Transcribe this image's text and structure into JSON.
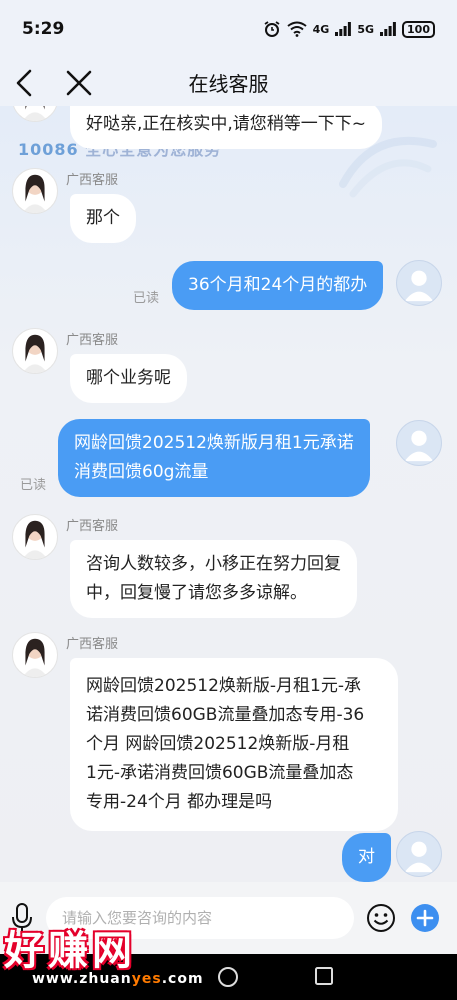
{
  "status_bar": {
    "time": "5:29",
    "network_4g": "4G",
    "network_5g": "5G",
    "battery": "100"
  },
  "header": {
    "title": "在线客服"
  },
  "watermark": {
    "brand": "10086",
    "text": "全心全意为您服务"
  },
  "messages": [
    {
      "side": "agent",
      "text": "好哒亲,正在核实中,请您稍等一下下~"
    },
    {
      "side": "agent",
      "sender": "广西客服",
      "text": "那个"
    },
    {
      "side": "user",
      "status": "已读",
      "text": "36个月和24个月的都办"
    },
    {
      "side": "agent",
      "sender": "广西客服",
      "text": "哪个业务呢"
    },
    {
      "side": "user",
      "status": "已读",
      "lines": [
        "网龄回馈202512焕新版月租1元承诺",
        "消费回馈60g流量"
      ]
    },
    {
      "side": "agent",
      "sender": "广西客服",
      "lines": [
        "咨询人数较多，小移正在努力回复",
        "中，回复慢了请您多多谅解。"
      ]
    },
    {
      "side": "agent",
      "sender": "广西客服",
      "lines": [
        "网龄回馈202512焕新版-月租1元-承",
        "诺消费回馈60GB流量叠加态专用-36",
        "个月   网龄回馈202512焕新版-月租",
        "1元-承诺消费回馈60GB流量叠加态",
        "专用-24个月  都办理是吗"
      ]
    },
    {
      "side": "user",
      "text": "对"
    }
  ],
  "input": {
    "placeholder": "请输入您要咨询的内容"
  },
  "site_logo": {
    "name": "好赚网",
    "url_prefix": "www.zhuan",
    "url_highlight": "yes",
    "url_suffix": ".com"
  }
}
